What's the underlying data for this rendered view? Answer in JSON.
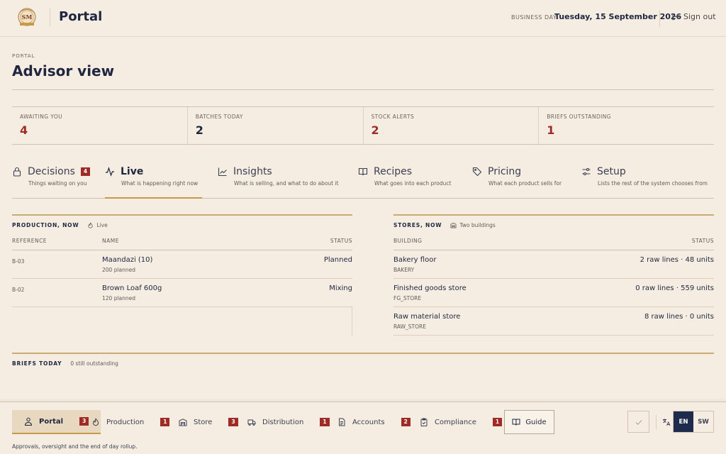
{
  "header": {
    "app_title": "Portal",
    "business_day_label": "BUSINESS DAY",
    "business_day_value": "Tuesday, 15 September 2026",
    "sign_out": "Sign out"
  },
  "page": {
    "eyebrow": "PORTAL",
    "title": "Advisor view"
  },
  "stats": [
    {
      "label": "AWAITING YOU",
      "value": "4",
      "color": "#9e2b25"
    },
    {
      "label": "BATCHES TODAY",
      "value": "2",
      "color": "#1f2640"
    },
    {
      "label": "STOCK ALERTS",
      "value": "2",
      "color": "#9e2b25"
    },
    {
      "label": "BRIEFS OUTSTANDING",
      "value": "1",
      "color": "#9e2b25"
    }
  ],
  "tabs": [
    {
      "label": "Decisions",
      "sub": "Things waiting on you",
      "badge": "4",
      "icon": "lock-icon"
    },
    {
      "label": "Live",
      "sub": "What is happening right now",
      "icon": "activity-icon",
      "active": true
    },
    {
      "label": "Insights",
      "sub": "What is selling, and what to do about it",
      "icon": "line-chart-icon"
    },
    {
      "label": "Recipes",
      "sub": "What goes into each product",
      "icon": "book-icon"
    },
    {
      "label": "Pricing",
      "sub": "What each product sells for",
      "icon": "tag-icon"
    },
    {
      "label": "Setup",
      "sub": "Lists the rest of the system chooses from",
      "icon": "sliders-icon"
    }
  ],
  "production": {
    "title": "PRODUCTION, NOW",
    "meta": "Live",
    "columns": [
      "REFERENCE",
      "NAME",
      "STATUS"
    ],
    "rows": [
      {
        "ref": "B-03",
        "name": "Maandazi (10)",
        "sub": "200 planned",
        "status": "Planned"
      },
      {
        "ref": "B-02",
        "name": "Brown Loaf 600g",
        "sub": "120 planned",
        "status": "Mixing"
      }
    ]
  },
  "stores": {
    "title": "STORES, NOW",
    "meta": "Two buildings",
    "columns": [
      "BUILDING",
      "STATUS"
    ],
    "rows": [
      {
        "name": "Bakery floor",
        "sub": "BAKERY",
        "status": "2 raw lines · 48 units"
      },
      {
        "name": "Finished goods store",
        "sub": "FG_STORE",
        "status": "0 raw lines · 559 units"
      },
      {
        "name": "Raw material store",
        "sub": "RAW_STORE",
        "status": "8 raw lines · 0 units"
      }
    ]
  },
  "briefs": {
    "title": "BRIEFS TODAY",
    "meta": "0 still outstanding"
  },
  "modules": [
    {
      "label": "Portal",
      "badge": "3",
      "icon": "user-icon",
      "active": true
    },
    {
      "label": "Production",
      "badge": "1",
      "icon": "flame-icon"
    },
    {
      "label": "Store",
      "badge": "3",
      "icon": "warehouse-icon"
    },
    {
      "label": "Distribution",
      "badge": "1",
      "icon": "truck-icon"
    },
    {
      "label": "Accounts",
      "badge": "2",
      "icon": "file-text-icon"
    },
    {
      "label": "Compliance",
      "badge": "1",
      "icon": "clipboard-check-icon"
    }
  ],
  "guide_label": "Guide",
  "languages": [
    "EN",
    "SW"
  ],
  "active_language": "EN",
  "footer_note": "Approvals, oversight and the end of day rollup.",
  "colors": {
    "accent": "#c79a4a",
    "alert": "#9e2b25",
    "navy": "#1f2b4d",
    "background": "#f5ede2"
  }
}
